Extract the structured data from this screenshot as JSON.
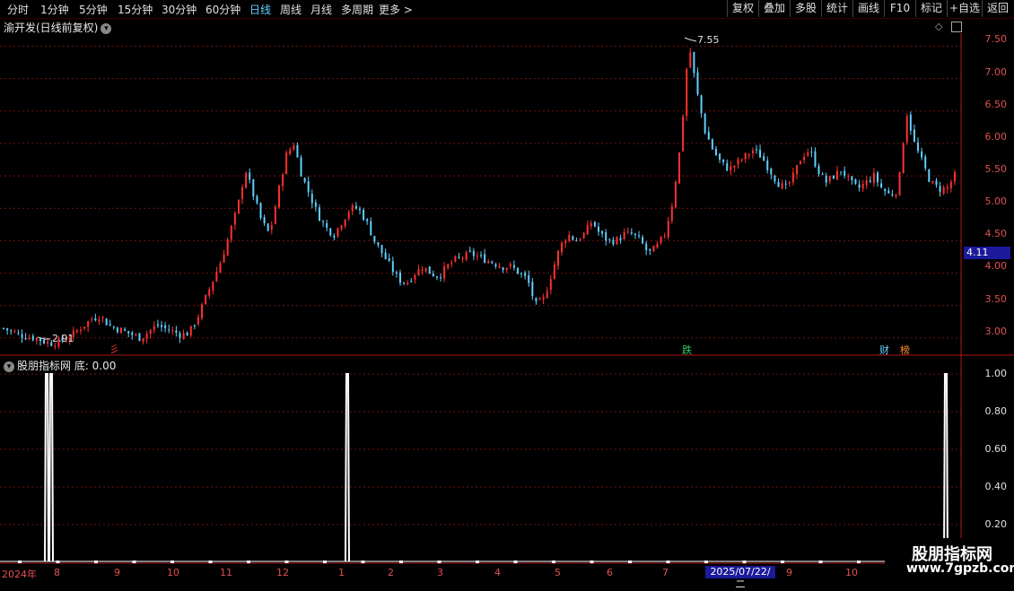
{
  "toolbar": {
    "periods": [
      "分时",
      "1分钟",
      "5分钟",
      "15分钟",
      "30分钟",
      "60分钟",
      "日线",
      "周线",
      "月线",
      "多周期",
      "更多 >"
    ],
    "active_period": "日线",
    "tools": [
      "复权",
      "叠加",
      "多股",
      "统计",
      "画线",
      "F10",
      "标记",
      "+自选",
      "返回"
    ]
  },
  "main_chart": {
    "stock_title": "渝开发(日线前复权)",
    "high_label": "7.55",
    "low_label": "2.91",
    "current_price": "4.11",
    "y_ticks": [
      "7.50",
      "7.00",
      "6.50",
      "6.00",
      "5.50",
      "5.00",
      "4.50",
      "4.00",
      "3.50",
      "3.00"
    ],
    "tags": {
      "jin": "彡",
      "die": "跌",
      "cai": "财",
      "bang": "榜"
    }
  },
  "indicator": {
    "title": "股朋指标网 底: 0.00",
    "y_ticks": [
      "1.00",
      "0.80",
      "0.60",
      "0.40",
      "0.20"
    ]
  },
  "x_axis": {
    "labels": [
      "2024年",
      "8",
      "9",
      "10",
      "11",
      "12",
      "1",
      "2",
      "3",
      "4",
      "5",
      "6",
      "7",
      "9",
      "10"
    ],
    "cursor_date": "2025/07/22/二"
  },
  "watermark": {
    "line1": "股朋指标网",
    "line2": "www.7gpzb.com"
  },
  "colors": {
    "up": "#ff3030",
    "down": "#5fd0ff",
    "grid": "#7a1010",
    "axis": "#b01818"
  },
  "chart_data": {
    "type": "candlestick",
    "title": "渝开发(日线前复权)",
    "ylim": [
      2.75,
      7.7
    ],
    "annotated_max": 7.55,
    "annotated_min": 2.91,
    "last_price": 4.11,
    "close_trend": [
      3.15,
      3.1,
      3.05,
      3.02,
      3.0,
      2.95,
      2.92,
      2.95,
      3.0,
      3.1,
      3.2,
      3.3,
      3.35,
      3.2,
      3.15,
      3.1,
      3.05,
      3.0,
      3.1,
      3.2,
      3.15,
      3.1,
      3.05,
      3.08,
      3.3,
      3.6,
      3.9,
      4.2,
      4.6,
      5.0,
      5.6,
      5.2,
      4.8,
      4.6,
      5.2,
      5.8,
      6.0,
      5.5,
      5.2,
      4.9,
      4.7,
      4.6,
      4.8,
      5.0,
      5.0,
      4.8,
      4.5,
      4.3,
      4.1,
      3.9,
      3.85,
      4.0,
      4.1,
      4.0,
      3.95,
      4.1,
      4.2,
      4.25,
      4.3,
      4.25,
      4.2,
      4.15,
      4.1,
      4.1,
      4.0,
      3.9,
      3.5,
      3.6,
      4.0,
      4.4,
      4.6,
      4.5,
      4.6,
      4.8,
      4.6,
      4.5,
      4.5,
      4.6,
      4.6,
      4.5,
      4.3,
      4.4,
      4.6,
      5.1,
      6.0,
      7.55,
      6.8,
      6.2,
      5.9,
      5.7,
      5.6,
      5.7,
      5.8,
      5.9,
      5.8,
      5.6,
      5.4,
      5.3,
      5.5,
      5.8,
      5.9,
      5.6,
      5.4,
      5.5,
      5.6,
      5.4,
      5.3,
      5.4,
      5.5,
      5.3,
      5.2,
      5.3,
      6.5,
      6.0,
      5.7,
      5.4,
      5.3,
      5.3,
      5.5
    ]
  }
}
